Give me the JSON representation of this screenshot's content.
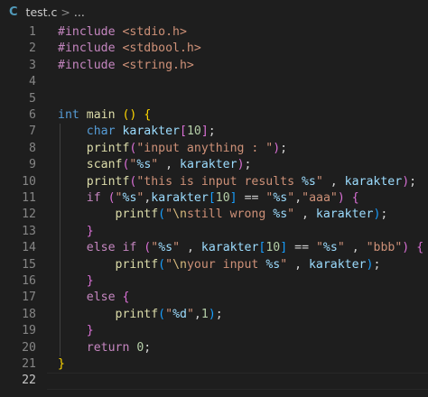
{
  "tab": {
    "lang_icon": "C",
    "filename": "test.c",
    "separator": ">",
    "breadcrumb_tail": "..."
  },
  "editor": {
    "active_line": 22,
    "lines": [
      {
        "n": "1",
        "segs": [
          [
            "ctrl",
            "#include "
          ],
          [
            "str",
            "<stdio.h>"
          ]
        ]
      },
      {
        "n": "2",
        "segs": [
          [
            "ctrl",
            "#include "
          ],
          [
            "str",
            "<stdbool.h>"
          ]
        ]
      },
      {
        "n": "3",
        "segs": [
          [
            "ctrl",
            "#include "
          ],
          [
            "str",
            "<string.h>"
          ]
        ]
      },
      {
        "n": "4",
        "segs": []
      },
      {
        "n": "5",
        "segs": []
      },
      {
        "n": "6",
        "segs": [
          [
            "kw",
            "int "
          ],
          [
            "fn",
            "main "
          ],
          [
            "b1",
            "()"
          ],
          [
            "pl",
            " "
          ],
          [
            "b1",
            "{"
          ]
        ]
      },
      {
        "n": "7",
        "segs": [
          [
            "pl",
            "    "
          ],
          [
            "kw",
            "char "
          ],
          [
            "var",
            "karakter"
          ],
          [
            "b2",
            "["
          ],
          [
            "num",
            "10"
          ],
          [
            "b2",
            "]"
          ],
          [
            "pl",
            ";"
          ]
        ]
      },
      {
        "n": "8",
        "segs": [
          [
            "pl",
            "    "
          ],
          [
            "fn",
            "printf"
          ],
          [
            "b2",
            "("
          ],
          [
            "str",
            "\"input anything : \""
          ],
          [
            "b2",
            ")"
          ],
          [
            "pl",
            ";"
          ]
        ]
      },
      {
        "n": "9",
        "segs": [
          [
            "pl",
            "    "
          ],
          [
            "fn",
            "scanf"
          ],
          [
            "b2",
            "("
          ],
          [
            "str",
            "\""
          ],
          [
            "fmt",
            "%s"
          ],
          [
            "str",
            "\""
          ],
          [
            "pl",
            " , "
          ],
          [
            "var",
            "karakter"
          ],
          [
            "b2",
            ")"
          ],
          [
            "pl",
            ";"
          ]
        ]
      },
      {
        "n": "10",
        "segs": [
          [
            "pl",
            "    "
          ],
          [
            "fn",
            "printf"
          ],
          [
            "b2",
            "("
          ],
          [
            "str",
            "\"this is input results "
          ],
          [
            "fmt",
            "%s"
          ],
          [
            "str",
            "\""
          ],
          [
            "pl",
            " , "
          ],
          [
            "var",
            "karakter"
          ],
          [
            "b2",
            ")"
          ],
          [
            "pl",
            ";"
          ]
        ]
      },
      {
        "n": "11",
        "segs": [
          [
            "pl",
            "    "
          ],
          [
            "ctrl",
            "if "
          ],
          [
            "b2",
            "("
          ],
          [
            "str",
            "\""
          ],
          [
            "fmt",
            "%s"
          ],
          [
            "str",
            "\""
          ],
          [
            "pl",
            ","
          ],
          [
            "var",
            "karakter"
          ],
          [
            "b3",
            "["
          ],
          [
            "num",
            "10"
          ],
          [
            "b3",
            "]"
          ],
          [
            "pl",
            " == "
          ],
          [
            "str",
            "\""
          ],
          [
            "fmt",
            "%s"
          ],
          [
            "str",
            "\""
          ],
          [
            "pl",
            ","
          ],
          [
            "str",
            "\"aaa\""
          ],
          [
            "b2",
            ")"
          ],
          [
            "pl",
            " "
          ],
          [
            "b2",
            "{"
          ]
        ]
      },
      {
        "n": "12",
        "segs": [
          [
            "pl",
            "        "
          ],
          [
            "fn",
            "printf"
          ],
          [
            "b3",
            "("
          ],
          [
            "str",
            "\""
          ],
          [
            "esc",
            "\\n"
          ],
          [
            "str",
            "still wrong "
          ],
          [
            "fmt",
            "%s"
          ],
          [
            "str",
            "\""
          ],
          [
            "pl",
            " , "
          ],
          [
            "var",
            "karakter"
          ],
          [
            "b3",
            ")"
          ],
          [
            "pl",
            ";"
          ]
        ]
      },
      {
        "n": "13",
        "segs": [
          [
            "pl",
            "    "
          ],
          [
            "b2",
            "}"
          ]
        ]
      },
      {
        "n": "14",
        "segs": [
          [
            "pl",
            "    "
          ],
          [
            "ctrl",
            "else if "
          ],
          [
            "b2",
            "("
          ],
          [
            "str",
            "\""
          ],
          [
            "fmt",
            "%s"
          ],
          [
            "str",
            "\""
          ],
          [
            "pl",
            " , "
          ],
          [
            "var",
            "karakter"
          ],
          [
            "b3",
            "["
          ],
          [
            "num",
            "10"
          ],
          [
            "b3",
            "]"
          ],
          [
            "pl",
            " == "
          ],
          [
            "str",
            "\""
          ],
          [
            "fmt",
            "%s"
          ],
          [
            "str",
            "\""
          ],
          [
            "pl",
            " , "
          ],
          [
            "str",
            "\"bbb\""
          ],
          [
            "b2",
            ")"
          ],
          [
            "pl",
            " "
          ],
          [
            "b2",
            "{"
          ]
        ]
      },
      {
        "n": "15",
        "segs": [
          [
            "pl",
            "        "
          ],
          [
            "fn",
            "printf"
          ],
          [
            "b3",
            "("
          ],
          [
            "str",
            "\""
          ],
          [
            "esc",
            "\\n"
          ],
          [
            "str",
            "your input "
          ],
          [
            "fmt",
            "%s"
          ],
          [
            "str",
            "\""
          ],
          [
            "pl",
            " , "
          ],
          [
            "var",
            "karakter"
          ],
          [
            "b3",
            ")"
          ],
          [
            "pl",
            ";"
          ]
        ]
      },
      {
        "n": "16",
        "segs": [
          [
            "pl",
            "    "
          ],
          [
            "b2",
            "}"
          ]
        ]
      },
      {
        "n": "17",
        "segs": [
          [
            "pl",
            "    "
          ],
          [
            "ctrl",
            "else "
          ],
          [
            "b2",
            "{"
          ]
        ]
      },
      {
        "n": "18",
        "segs": [
          [
            "pl",
            "        "
          ],
          [
            "fn",
            "printf"
          ],
          [
            "b3",
            "("
          ],
          [
            "str",
            "\""
          ],
          [
            "fmt",
            "%d"
          ],
          [
            "str",
            "\""
          ],
          [
            "pl",
            ","
          ],
          [
            "num",
            "1"
          ],
          [
            "b3",
            ")"
          ],
          [
            "pl",
            ";"
          ]
        ]
      },
      {
        "n": "19",
        "segs": [
          [
            "pl",
            "    "
          ],
          [
            "b2",
            "}"
          ]
        ]
      },
      {
        "n": "20",
        "segs": [
          [
            "pl",
            "    "
          ],
          [
            "ctrl",
            "return "
          ],
          [
            "num",
            "0"
          ],
          [
            "pl",
            ";"
          ]
        ]
      },
      {
        "n": "21",
        "segs": [
          [
            "b1",
            "}"
          ]
        ]
      },
      {
        "n": "22",
        "segs": []
      }
    ]
  },
  "colors": {
    "background": "#1e1e1e",
    "keyword": "#569cd6",
    "control": "#c586c0",
    "function": "#dcdcaa",
    "string": "#ce9178",
    "number": "#b5cea8",
    "variable": "#9cdcfe"
  }
}
